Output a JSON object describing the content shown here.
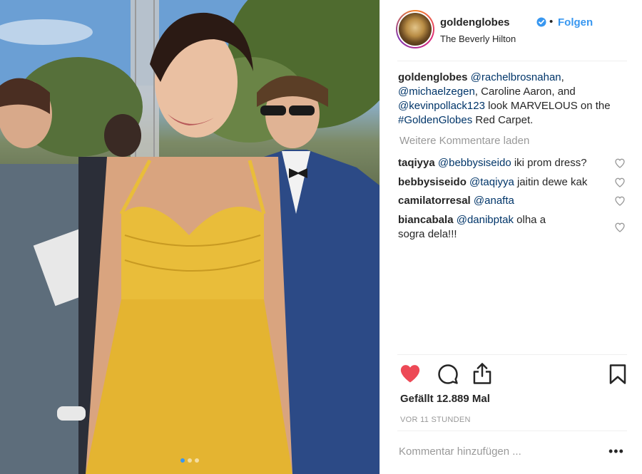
{
  "header": {
    "username": "goldenglobes",
    "separator": "•",
    "follow_label": "Folgen",
    "location": "The Beverly Hilton"
  },
  "caption": {
    "user": "goldenglobes",
    "parts": [
      {
        "text": "@rachelbrosnahan",
        "mention": true
      },
      {
        "text": ",",
        "mention": false
      },
      {
        "text": "@michaelzegen",
        "mention": true
      },
      {
        "text": ", Caroline Aaron, and",
        "mention": false
      },
      {
        "text": "@kevinpollack123",
        "mention": true
      },
      {
        "text": " look MARVELOUS on the",
        "mention": false
      },
      {
        "text": "#GoldenGlobes",
        "mention": true
      },
      {
        "text": " Red Carpet.",
        "mention": false
      }
    ]
  },
  "load_more_label": "Weitere Kommentare laden",
  "comments": [
    {
      "user": "taqiyya",
      "mention": "@bebbysiseido",
      "text": " iki prom dress?"
    },
    {
      "user": "bebbysiseido",
      "mention": "@taqiyya",
      "text": " jaitin dewe kak"
    },
    {
      "user": "camilatorresal",
      "mention": "@anafta",
      "text": ""
    },
    {
      "user": "biancabala",
      "mention": "@danibptak",
      "text": " olha a sogra dela!!!"
    }
  ],
  "likes_label": "Gefällt 12.889 Mal",
  "time_label": "VOR 11 STUNDEN",
  "comment_placeholder": "Kommentar hinzufügen ...",
  "more_label": "•••",
  "carousel": {
    "count": 3,
    "active_index": 0
  },
  "colors": {
    "accent": "#3897f0",
    "mention": "#003569",
    "like_red": "#ed4956",
    "muted": "#999999"
  },
  "icons": {
    "like": "heart-icon",
    "comment": "comment-icon",
    "share": "share-icon",
    "save": "bookmark-icon",
    "verified": "verified-badge-icon"
  }
}
